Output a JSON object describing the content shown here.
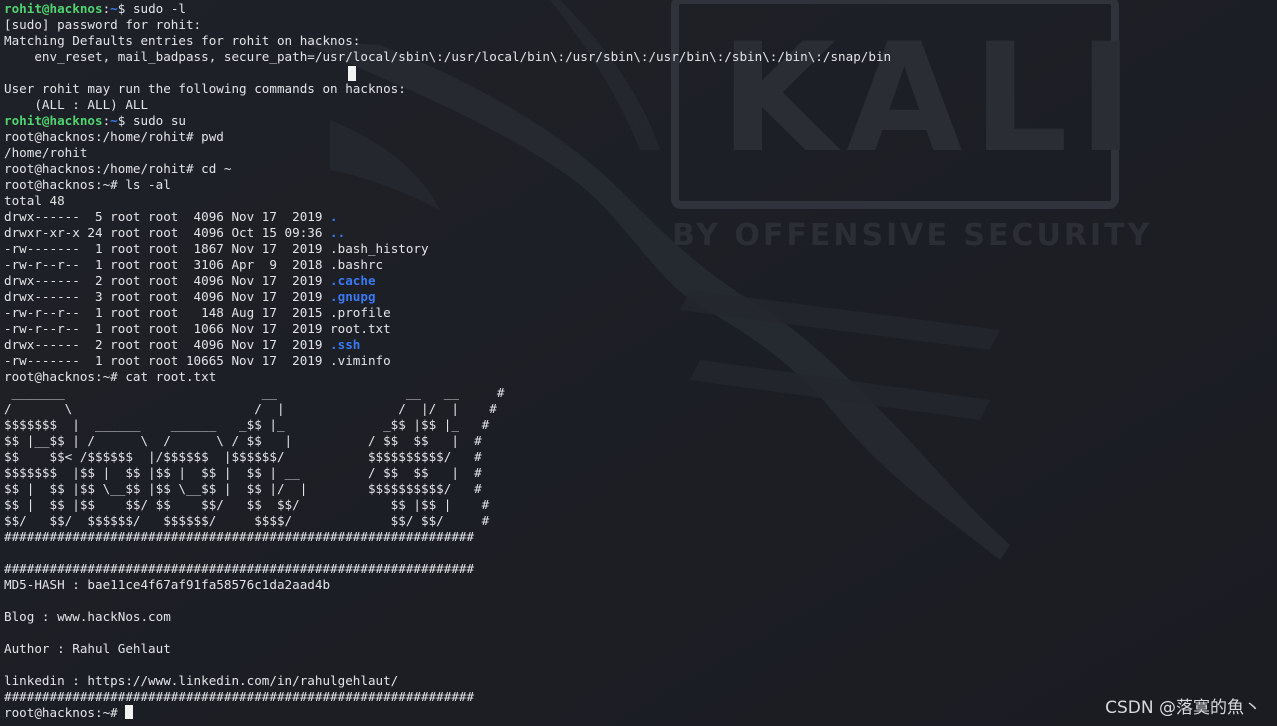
{
  "background": {
    "color": "#1b1d23",
    "logo_text": "KALI",
    "logo_tagline": "BY OFFENSIVE SECURITY"
  },
  "terminal": {
    "prompt_user": {
      "user": "rohit@hacknos",
      "sep": ":",
      "path": "~",
      "sym": "$ "
    },
    "lines": [
      {
        "type": "prompt_user",
        "cmd": "sudo -l"
      },
      {
        "type": "text",
        "text": "[sudo] password for rohit:"
      },
      {
        "type": "text",
        "text": "Matching Defaults entries for rohit on hacknos:"
      },
      {
        "type": "text",
        "text": "    env_reset, mail_badpass, secure_path=/usr/local/sbin\\:/usr/local/bin\\:/usr/sbin\\:/usr/bin\\:/sbin\\:/bin\\:/snap/bin"
      },
      {
        "type": "text",
        "text": ""
      },
      {
        "type": "text",
        "text": "User rohit may run the following commands on hacknos:"
      },
      {
        "type": "text",
        "text": "    (ALL : ALL) ALL"
      },
      {
        "type": "prompt_user",
        "cmd": "sudo su"
      },
      {
        "type": "text",
        "text": "root@hacknos:/home/rohit# pwd"
      },
      {
        "type": "text",
        "text": "/home/rohit"
      },
      {
        "type": "text",
        "text": "root@hacknos:/home/rohit# cd ~"
      },
      {
        "type": "text",
        "text": "root@hacknos:~# ls -al"
      },
      {
        "type": "text",
        "text": "total 48"
      },
      {
        "type": "ls",
        "perm": "drwx------  5 root root  4096 Nov 17  2019 ",
        "name": ".",
        "dir": true
      },
      {
        "type": "ls",
        "perm": "drwxr-xr-x 24 root root  4096 Oct 15 09:36 ",
        "name": "..",
        "dir": true
      },
      {
        "type": "ls",
        "perm": "-rw-------  1 root root  1867 Nov 17  2019 ",
        "name": ".bash_history",
        "dir": false
      },
      {
        "type": "ls",
        "perm": "-rw-r--r--  1 root root  3106 Apr  9  2018 ",
        "name": ".bashrc",
        "dir": false
      },
      {
        "type": "ls",
        "perm": "drwx------  2 root root  4096 Nov 17  2019 ",
        "name": ".cache",
        "dir": true
      },
      {
        "type": "ls",
        "perm": "drwx------  3 root root  4096 Nov 17  2019 ",
        "name": ".gnupg",
        "dir": true
      },
      {
        "type": "ls",
        "perm": "-rw-r--r--  1 root root   148 Aug 17  2015 ",
        "name": ".profile",
        "dir": false
      },
      {
        "type": "ls",
        "perm": "-rw-r--r--  1 root root  1066 Nov 17  2019 ",
        "name": "root.txt",
        "dir": false
      },
      {
        "type": "ls",
        "perm": "drwx------  2 root root  4096 Nov 17  2019 ",
        "name": ".ssh",
        "dir": true
      },
      {
        "type": "ls",
        "perm": "-rw-------  1 root root 10665 Nov 17  2019 ",
        "name": ".viminfo",
        "dir": false
      },
      {
        "type": "text",
        "text": "root@hacknos:~# cat root.txt"
      },
      {
        "type": "text",
        "text": " _______                          __                 __   __     #"
      },
      {
        "type": "text",
        "text": "/       \\                        /  |               /  |/  |    #"
      },
      {
        "type": "text",
        "text": "$$$$$$$  |  ______    ______   _$$ |_             _$$ |$$ |_   #"
      },
      {
        "type": "text",
        "text": "$$ |__$$ | /      \\  /      \\ / $$   |          / $$  $$   |  #"
      },
      {
        "type": "text",
        "text": "$$    $$< /$$$$$$  |/$$$$$$  |$$$$$$/           $$$$$$$$$$/   #"
      },
      {
        "type": "text",
        "text": "$$$$$$$  |$$ |  $$ |$$ |  $$ |  $$ | __         / $$  $$   |  #"
      },
      {
        "type": "text",
        "text": "$$ |  $$ |$$ \\__$$ |$$ \\__$$ |  $$ |/  |        $$$$$$$$$$/   #"
      },
      {
        "type": "text",
        "text": "$$ |  $$ |$$    $$/ $$    $$/   $$  $$/            $$ |$$ |    #"
      },
      {
        "type": "text",
        "text": "$$/   $$/  $$$$$$/   $$$$$$/     $$$$/             $$/ $$/     #"
      },
      {
        "type": "text",
        "text": "##############################################################"
      },
      {
        "type": "text",
        "text": ""
      },
      {
        "type": "text",
        "text": "##############################################################"
      },
      {
        "type": "text",
        "text": "MD5-HASH : bae11ce4f67af91fa58576c1da2aad4b"
      },
      {
        "type": "text",
        "text": ""
      },
      {
        "type": "text",
        "text": "Blog : www.hackNos.com"
      },
      {
        "type": "text",
        "text": ""
      },
      {
        "type": "text",
        "text": "Author : Rahul Gehlaut"
      },
      {
        "type": "text",
        "text": ""
      },
      {
        "type": "text",
        "text": "linkedin : https://www.linkedin.com/in/rahulgehlaut/"
      },
      {
        "type": "text",
        "text": "##############################################################"
      },
      {
        "type": "prompt_root_cursor",
        "text": "root@hacknos:~# "
      }
    ]
  },
  "watermark": "CSDN @落寞的魚丶",
  "colors": {
    "user_prompt": "#4fd46e",
    "path_prompt": "#3a78f2",
    "directory": "#3a78f2",
    "text": "#e2e4e8"
  }
}
